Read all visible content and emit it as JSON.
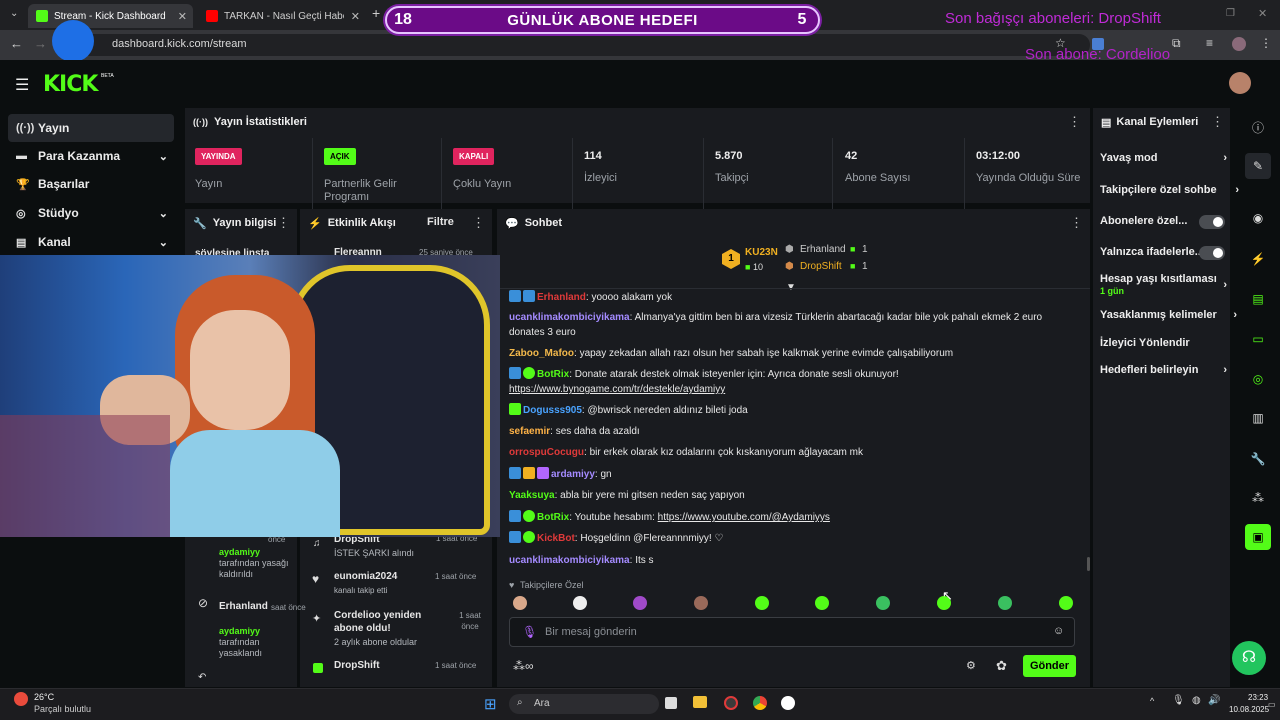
{
  "browser": {
    "tabs": [
      {
        "label": "Stream - Kick Dashboard",
        "active": true
      },
      {
        "label": "TARKAN - Nasıl Geçti Habersiz",
        "active": false
      }
    ],
    "url": "dashboard.kick.com/stream"
  },
  "overlay": {
    "goal_left": "18",
    "goal_title": "GÜNLÜK ABONE HEDEFI",
    "goal_right": "5",
    "last_donor": "Son bağışçı aboneleri: DropShift",
    "last_sub": "Son abone: Cordelioo"
  },
  "brand": {
    "logo": "KICK",
    "beta": "BETA",
    "accent": "#53fc18"
  },
  "nav": [
    {
      "label": "Yayın",
      "icon": "broadcast-icon",
      "active": true
    },
    {
      "label": "Para Kazanma",
      "icon": "money-icon",
      "chevron": true
    },
    {
      "label": "Başarılar",
      "icon": "trophy-icon"
    },
    {
      "label": "Stüdyo",
      "icon": "studio-icon",
      "chevron": true
    },
    {
      "label": "Kanal",
      "icon": "channel-icon",
      "chevron": true
    }
  ],
  "stats": {
    "title": "Yayın İstatistikleri",
    "cells": [
      {
        "badge": "YAYINDA",
        "label": "Yayın"
      },
      {
        "badge": "AÇIK",
        "label": "Partnerlik Gelir Programı"
      },
      {
        "badge": "KAPALI",
        "label": "Çoklu Yayın"
      },
      {
        "value": "114",
        "label": "İzleyici"
      },
      {
        "value": "5.870",
        "label": "Takipçi"
      },
      {
        "value": "42",
        "label": "Abone Sayısı"
      },
      {
        "value": "03:12:00",
        "label": "Yayında Olduğu Süre"
      }
    ]
  },
  "yayin_bilgisi": {
    "title": "Yayın bilgisi",
    "preview": "söyleşine linsta"
  },
  "etkinlik": {
    "title": "Etkinlik Akışı",
    "filter": "Filtre",
    "items": [
      {
        "user": "Flereannn",
        "time": "25 saniye önce"
      },
      {
        "user": "DropShift",
        "sub": "İSTEK ŞARKI alındı",
        "time": "1 saat önce"
      },
      {
        "user": "eunomia2024",
        "sub": "kanalı takip etti",
        "time": "1 saat önce"
      },
      {
        "user": "Cordelioo yeniden abone oldu!",
        "sub": "2 aylık abone oldular",
        "time": "1 saat önce"
      },
      {
        "user": "DropShift",
        "time": "1 saat önce"
      }
    ],
    "mod_actions": [
      {
        "user": "aydamiyy",
        "text": "tarafından yasağı kaldırıldı",
        "time": "önce"
      },
      {
        "user": "Erhanland",
        "actor": "aydamiyy",
        "text": "tarafından yasaklandı",
        "time": "saat önce"
      }
    ]
  },
  "chat": {
    "title": "Sohbet",
    "leaderboard": {
      "top": {
        "name": "KU23N",
        "rank": "1",
        "count": "10"
      },
      "list": [
        {
          "name": "Erhanland",
          "count": "1"
        },
        {
          "name": "DropShift",
          "count": "1"
        }
      ]
    },
    "messages": [
      {
        "user": "Erhanland",
        "text": "yoooo alakam yok",
        "color": "#e03a3a"
      },
      {
        "user": "ucanklimakombiciyikama",
        "text": "Almanya'ya gittim ben bi ara vizesiz Türklerin abartacağı kadar bile yok pahalı ekmek 2 euro donates 3 euro",
        "color": "#a48bff"
      },
      {
        "user": "Zaboo_Mafoo",
        "text": "yapay zekadan allah razı olsun her sabah işe kalkmak yerine evimde çalışabiliyorum",
        "color": "#f2b84b"
      },
      {
        "user": "BotRix",
        "text": "Donate atarak destek olmak isteyenler için: Ayrıca donate sesli okunuyor!",
        "link": "https://www.bynogame.com/tr/destekle/aydamiyy",
        "color": "#53fc18"
      },
      {
        "user": "Dogusss905",
        "text": "@bwrisck nereden aldınız bileti joda",
        "color": "#4aa3ff"
      },
      {
        "user": "sefaemir",
        "text": "ses daha da azaldı",
        "color": "#ffb347"
      },
      {
        "user": "orrospuCocugu",
        "text": "bir erkek olarak kız odalarını çok kıskanıyorum ağlayacam mk",
        "color": "#e03a3a"
      },
      {
        "user": "ardamiyy",
        "text": "gn",
        "color": "#a48bff"
      },
      {
        "user": "Yaaksuya",
        "text": "abla bir yere mi gitsen neden saç yapıyon",
        "color": "#53fc18"
      },
      {
        "user": "BotRix",
        "text": "Youtube hesabım:",
        "link": "https://www.youtube.com/@Aydamiyys",
        "color": "#53fc18"
      },
      {
        "user": "KickBot",
        "text": "Hoşgeldinn @Flereannnmiyy! ♡",
        "color": "#e03a3a"
      },
      {
        "user": "ucanklimakombiciyikama",
        "text": "Its s",
        "color": "#a48bff"
      }
    ],
    "followers_only": "Takipçilere Özel",
    "placeholder": "Bir mesaj gönderin",
    "send_label": "Gönder"
  },
  "kanal_eylemleri": {
    "title": "Kanal Eylemleri",
    "items": [
      {
        "label": "Yavaş mod",
        "kind": "chevron"
      },
      {
        "label": "Takipçilere özel sohbe",
        "kind": "chevron"
      },
      {
        "label": "Abonelere özel...",
        "kind": "toggle"
      },
      {
        "label": "Yalnızca ifadelerle...",
        "kind": "toggle"
      },
      {
        "label": "Hesap yaşı kısıtlaması",
        "sub": "1 gün",
        "kind": "chevron"
      },
      {
        "label": "Yasaklanmış kelimeler",
        "kind": "chevron"
      },
      {
        "label": "İzleyici Yönlendir",
        "kind": "none"
      },
      {
        "label": "Hedefleri belirleyin",
        "kind": "chevron"
      }
    ]
  },
  "taskbar": {
    "weather_temp": "26°C",
    "weather_desc": "Parçalı bulutlu",
    "search": "Ara",
    "time": "23:23",
    "date": "10.08.2025"
  }
}
